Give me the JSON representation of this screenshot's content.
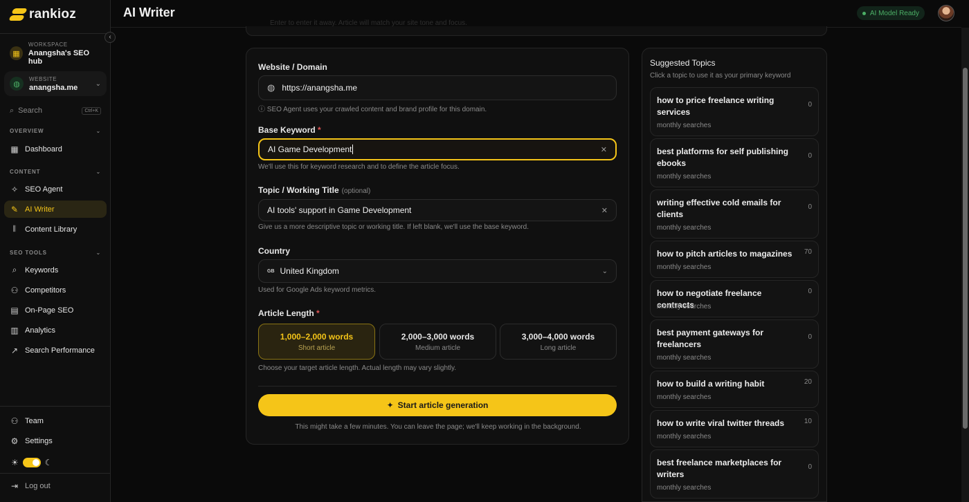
{
  "brand": {
    "name": "rankioz",
    "accent": "#f5c518"
  },
  "header": {
    "title": "AI Writer",
    "status": "AI Model Ready"
  },
  "sidebar": {
    "collapse_icon": "chevron-left-icon",
    "workspace": {
      "label": "WORKSPACE",
      "name": "Anangsha's SEO hub"
    },
    "website": {
      "label": "WEBSITE",
      "name": "anangsha.me"
    },
    "search": {
      "placeholder": "Search",
      "shortcut": "Ctrl+K"
    },
    "sections": {
      "overview": "OVERVIEW",
      "content": "CONTENT",
      "seo_tools": "SEO TOOLS"
    },
    "items": {
      "dashboard": "Dashboard",
      "seo_agent": "SEO Agent",
      "ai_writer": "AI Writer",
      "content_library": "Content Library",
      "keywords": "Keywords",
      "competitors": "Competitors",
      "onpage": "On-Page SEO",
      "analytics": "Analytics",
      "search_performance": "Search Performance",
      "team": "Team",
      "settings": "Settings",
      "logout": "Log out"
    }
  },
  "top_card_text": "Enter to enter it away. Article will match your site tone and focus.",
  "form": {
    "website": {
      "label": "Website / Domain",
      "value": "https://anangsha.me",
      "hint": "ⓘ SEO Agent uses your crawled content and brand profile for this domain."
    },
    "keyword": {
      "label": "Base Keyword",
      "required": "*",
      "value": "AI Game Development",
      "hint": "We'll use this for keyword research and to define the article focus."
    },
    "topic": {
      "label": "Topic / Working Title",
      "optional": "(optional)",
      "value": "AI tools' support in Game Development",
      "hint": "Give us a more descriptive topic or working title. If left blank, we'll use the base keyword."
    },
    "country": {
      "label": "Country",
      "flag": "GB",
      "value": "United Kingdom",
      "hint": "Used for Google Ads keyword metrics."
    },
    "length": {
      "label": "Article Length",
      "required": "*",
      "options": [
        {
          "words": "1,000–2,000 words",
          "desc": "Short article"
        },
        {
          "words": "2,000–3,000 words",
          "desc": "Medium article"
        },
        {
          "words": "3,000–4,000 words",
          "desc": "Long article"
        }
      ],
      "hint": "Choose your target article length. Actual length may vary slightly."
    },
    "cta": "Start article generation",
    "footnote": "This might take a few minutes. You can leave the page; we'll keep working in the background."
  },
  "topics": {
    "title": "Suggested Topics",
    "subtitle": "Click a topic to use it as your primary keyword",
    "meta_label": "monthly searches",
    "items": [
      {
        "title": "how to price freelance writing services",
        "count": "0"
      },
      {
        "title": "best platforms for self publishing ebooks",
        "count": "0"
      },
      {
        "title": "writing effective cold emails for clients",
        "count": "0"
      },
      {
        "title": "how to pitch articles to magazines",
        "count": "70"
      },
      {
        "title": "how to negotiate freelance contracts",
        "count": "0"
      },
      {
        "title": "best payment gateways for freelancers",
        "count": "0"
      },
      {
        "title": "how to build a writing habit",
        "count": "20"
      },
      {
        "title": "how to write viral twitter threads",
        "count": "10"
      },
      {
        "title": "best freelance marketplaces for writers",
        "count": "0"
      }
    ]
  }
}
